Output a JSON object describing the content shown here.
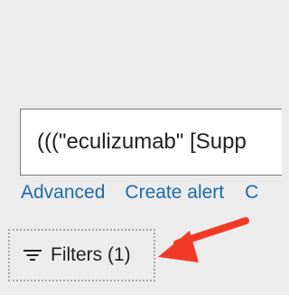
{
  "search": {
    "query_value": "(((\"eculizumab\" [Supp"
  },
  "search_links": {
    "advanced": "Advanced",
    "create_alert": "Create alert",
    "more_partial": "C"
  },
  "filters": {
    "label": "Filters (1)",
    "icon": "filter-lines-icon"
  },
  "annotation": {
    "arrow_color": "#f03a26"
  },
  "colors": {
    "background": "#ececec",
    "link": "#1f6aa8",
    "text": "#212121"
  }
}
